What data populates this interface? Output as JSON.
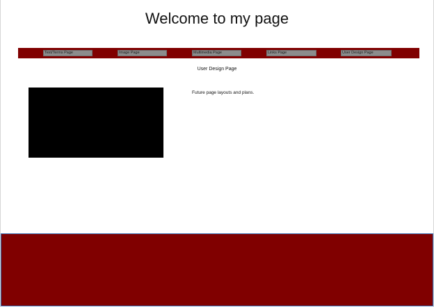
{
  "header": {
    "title": "Welcome to my page"
  },
  "nav": {
    "items": [
      {
        "label": "Text/Terms Page"
      },
      {
        "label": "Image Page"
      },
      {
        "label": "Multimedia Page"
      },
      {
        "label": "Links Page"
      },
      {
        "label": "User Design Page"
      }
    ]
  },
  "main": {
    "heading": "User Design Page",
    "description": "Future page layouts and plans."
  },
  "colors": {
    "accent": "#800000",
    "nav_button": "#8c8c8c",
    "media": "#000000",
    "footer_border": "#3b6fb5"
  }
}
